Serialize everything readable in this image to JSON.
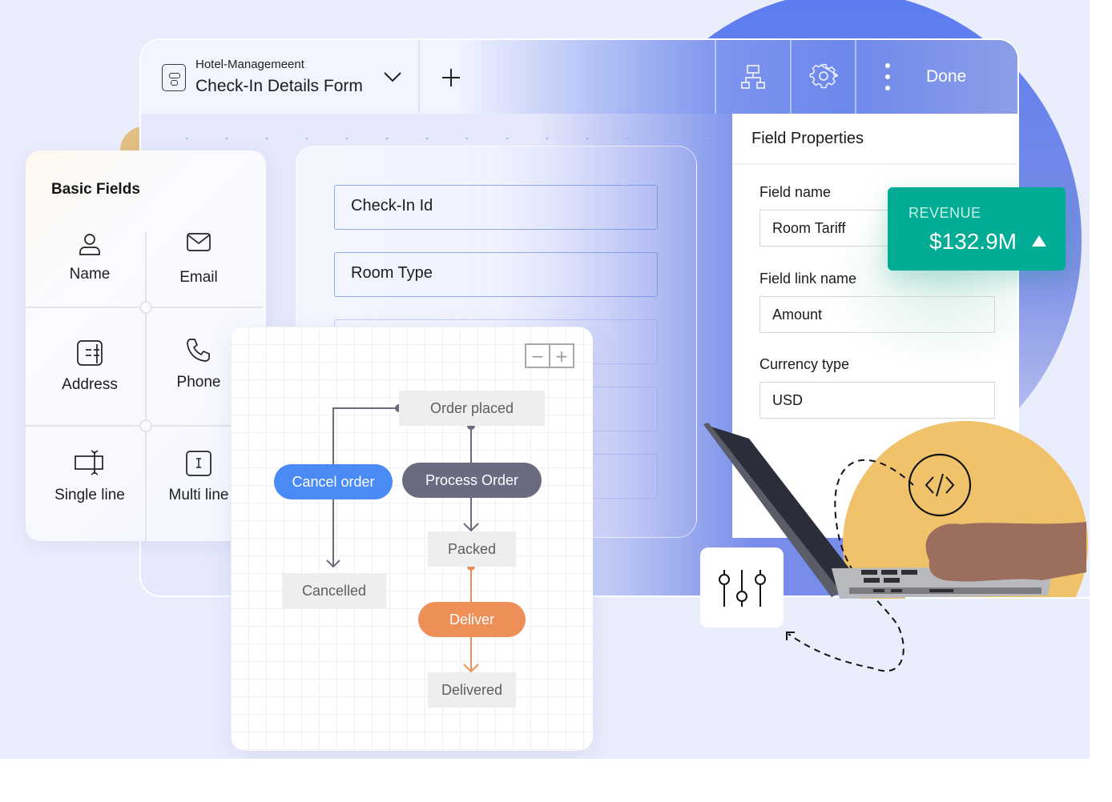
{
  "toolbar": {
    "app_name": "Hotel-Managemeent",
    "form_title": "Check-In Details Form",
    "dropdown_icon": "chevron-down-icon",
    "add_icon": "plus-icon",
    "workflow_icon": "org-chart-icon",
    "settings_icon": "gear-icon",
    "more_icon": "vertical-ellipsis-icon",
    "done_label": "Done"
  },
  "canvas": {
    "fields": [
      {
        "label": "Check-In Id"
      },
      {
        "label": "Room Type"
      },
      {
        "label": ""
      },
      {
        "label": ""
      },
      {
        "label": ""
      }
    ]
  },
  "basic_fields": {
    "title": "Basic Fields",
    "items": [
      {
        "label": "Name",
        "icon": "user-icon"
      },
      {
        "label": "Email",
        "icon": "envelope-icon"
      },
      {
        "label": "Address",
        "icon": "address-icon"
      },
      {
        "label": "Phone",
        "icon": "phone-icon"
      },
      {
        "label": "Single line",
        "icon": "single-line-icon"
      },
      {
        "label": "Multi line",
        "icon": "multi-line-icon"
      }
    ]
  },
  "field_properties": {
    "title": "Field Properties",
    "field_name_label": "Field name",
    "field_name_value": "Room Tariff",
    "field_link_label": "Field link name",
    "field_link_value": "Amount",
    "currency_label": "Currency type",
    "currency_value": "USD"
  },
  "revenue_card": {
    "label": "REVENUE",
    "value": "$132.9M",
    "trend": "up"
  },
  "workflow": {
    "zoom_out": "−",
    "zoom_in": "+",
    "states": {
      "order_placed": "Order placed",
      "packed": "Packed",
      "cancelled": "Cancelled",
      "delivered": "Delivered"
    },
    "actions": {
      "cancel_order": "Cancel order",
      "process_order": "Process Order",
      "deliver": "Deliver"
    },
    "colors": {
      "cancel": "#4a8af4",
      "process": "#6a6b80",
      "deliver": "#ef8f58"
    }
  },
  "decorations": {
    "code_icon": "code-brackets-icon",
    "sliders_icon": "sliders-icon"
  }
}
